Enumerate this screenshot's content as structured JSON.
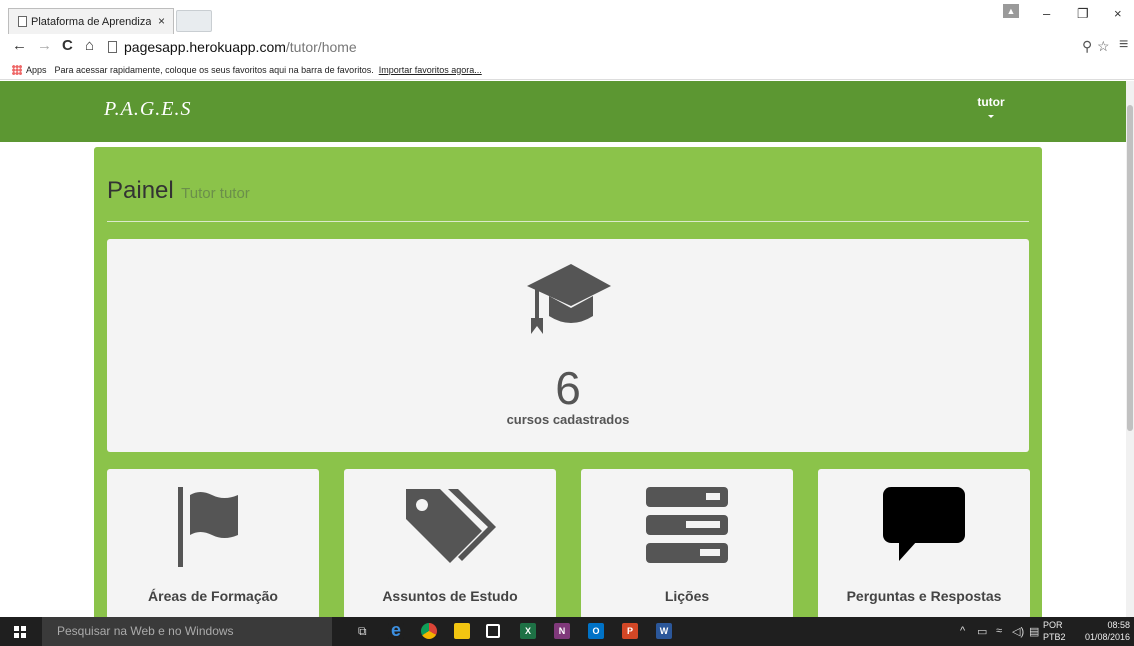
{
  "browser": {
    "tab_title": "Plataforma de Aprendizag",
    "tab_close": "×",
    "url_host": "pagesapp.herokuapp.com",
    "url_path": "/tutor/home",
    "back_glyph": "←",
    "forward_glyph": "→",
    "reload_glyph": "C",
    "home_glyph": "⌂",
    "key_glyph": "⚲",
    "star_glyph": "☆",
    "menu_glyph": "≡",
    "minimize_glyph": "–",
    "restore_glyph": "❐",
    "close_glyph": "×"
  },
  "bookmarks": {
    "apps_label": "Apps",
    "hint": "Para acessar rapidamente, coloque os seus favoritos aqui na barra de favoritos.",
    "import_link": "Importar favoritos agora..."
  },
  "navbar": {
    "brand": "P.A.G.E.S",
    "user": "tutor"
  },
  "panel": {
    "title": "Painel",
    "subtitle": "Tutor tutor",
    "stat": {
      "count": "6",
      "label": "cursos cadastrados",
      "icon": "graduation-cap-icon"
    },
    "cards": [
      {
        "label": "Áreas de Formação",
        "icon": "flag-icon"
      },
      {
        "label": "Assuntos de Estudo",
        "icon": "tags-icon"
      },
      {
        "label": "Lições",
        "icon": "server-icon"
      },
      {
        "label": "Perguntas e Respostas",
        "icon": "comment-icon"
      }
    ]
  },
  "taskbar": {
    "search_placeholder": "Pesquisar na Web e no Windows",
    "lang_top": "POR",
    "lang_bottom": "PTB2",
    "time": "08:58",
    "date": "01/08/2016",
    "apps": [
      {
        "name": "Excel",
        "letter": "X",
        "color": "#1e7145"
      },
      {
        "name": "OneNote",
        "letter": "N",
        "color": "#80397b"
      },
      {
        "name": "Outlook",
        "letter": "O",
        "color": "#0072c6"
      },
      {
        "name": "PowerPoint",
        "letter": "P",
        "color": "#d24726"
      },
      {
        "name": "Word",
        "letter": "W",
        "color": "#2b579a"
      }
    ]
  },
  "colors": {
    "navbar": "#5c9732",
    "panel": "#8bc34a",
    "card": "#f4f4f4",
    "icon": "#555555"
  }
}
